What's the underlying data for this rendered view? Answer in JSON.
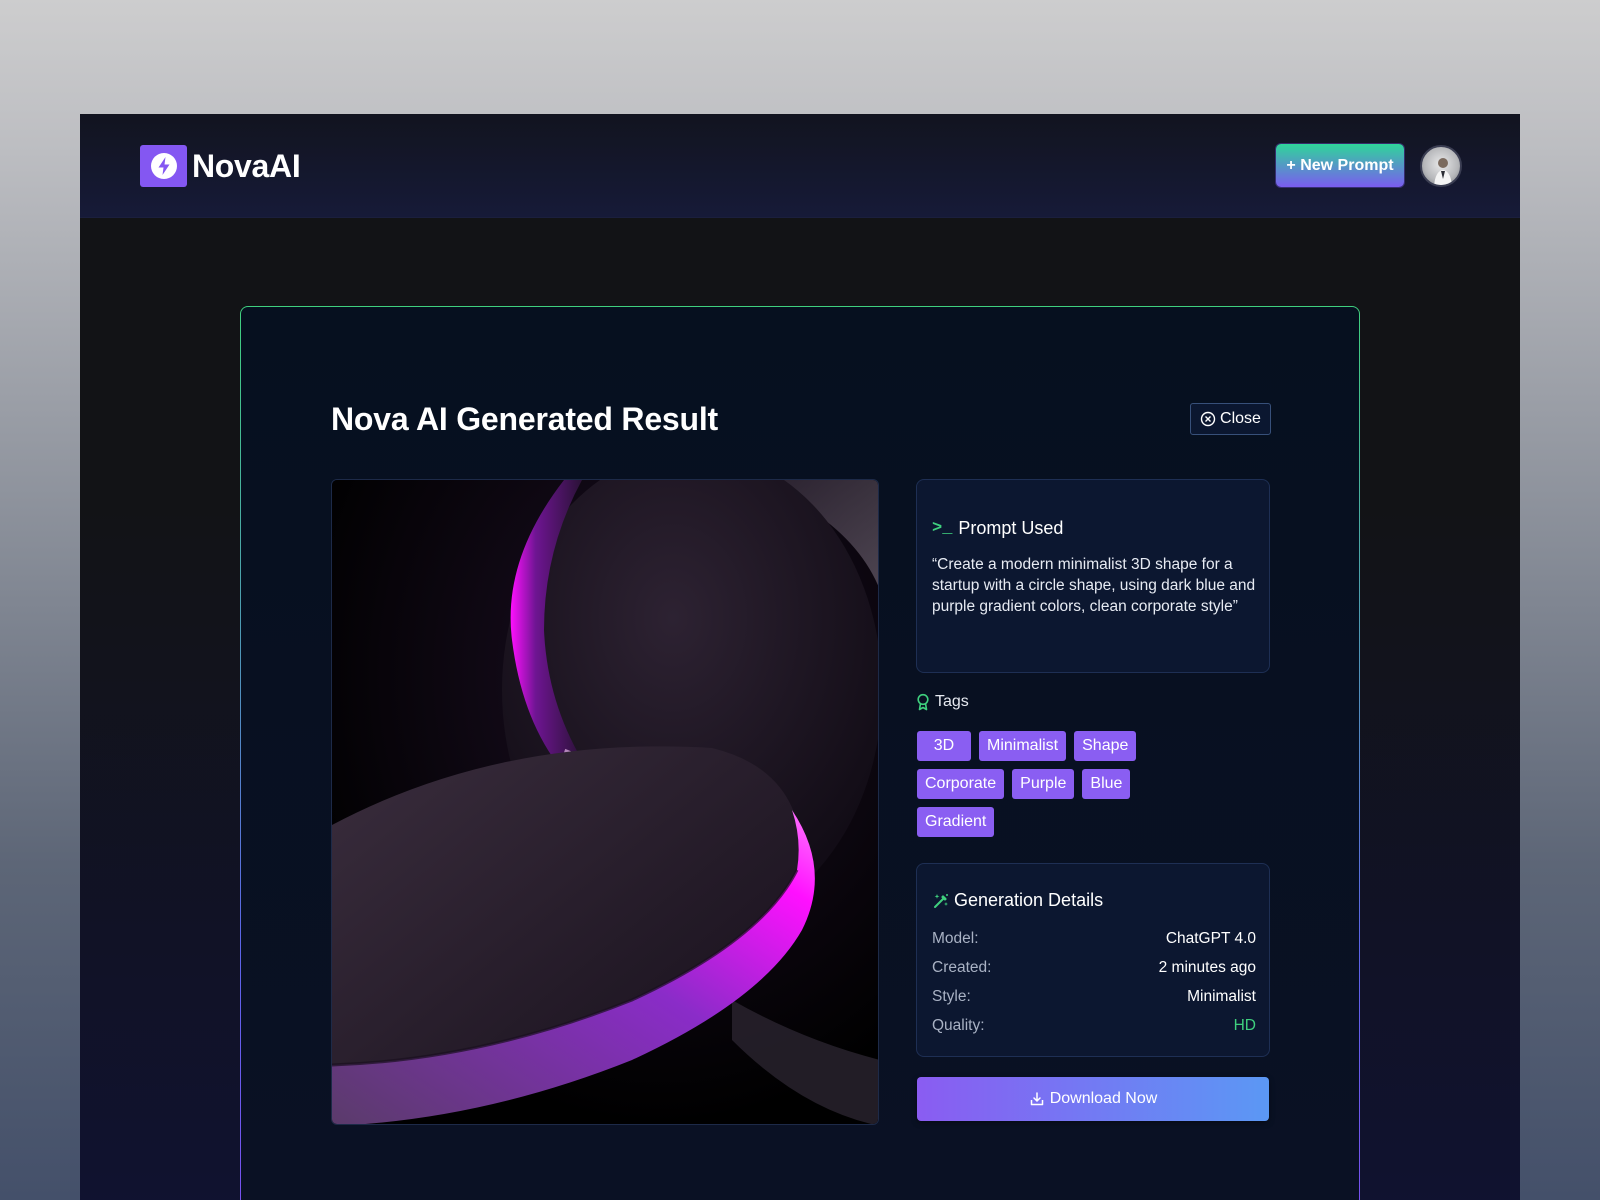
{
  "brand": {
    "name": "NovaAI",
    "logo_icon": "bolt-icon",
    "accent": "#8457f2"
  },
  "header": {
    "new_prompt_label": "+ New Prompt",
    "avatar": "user-avatar"
  },
  "result": {
    "title": "Nova AI Generated Result",
    "close_label": "Close",
    "image_description": "3D purple and magenta circular shape render"
  },
  "prompt": {
    "heading": "Prompt Used",
    "icon": ">_",
    "text": "“Create a modern minimalist 3D shape for a startup with a circle shape, using dark blue and purple gradient colors, clean corporate style”"
  },
  "tags": {
    "heading": "Tags",
    "items": [
      "3D",
      "Minimalist",
      "Shape",
      "Corporate",
      "Purple",
      "Blue",
      "Gradient"
    ]
  },
  "details": {
    "heading": "Generation Details",
    "rows": [
      {
        "label": "Model:",
        "value": "ChatGPT 4.0"
      },
      {
        "label": "Created:",
        "value": "2 minutes ago"
      },
      {
        "label": "Style:",
        "value": "Minimalist"
      },
      {
        "label": "Quality:",
        "value": "HD"
      }
    ]
  },
  "download_label": "Download Now",
  "colors": {
    "green": "#3fd07e",
    "tag_purple": "#8a5ef2",
    "card_bg": "#06101f"
  }
}
